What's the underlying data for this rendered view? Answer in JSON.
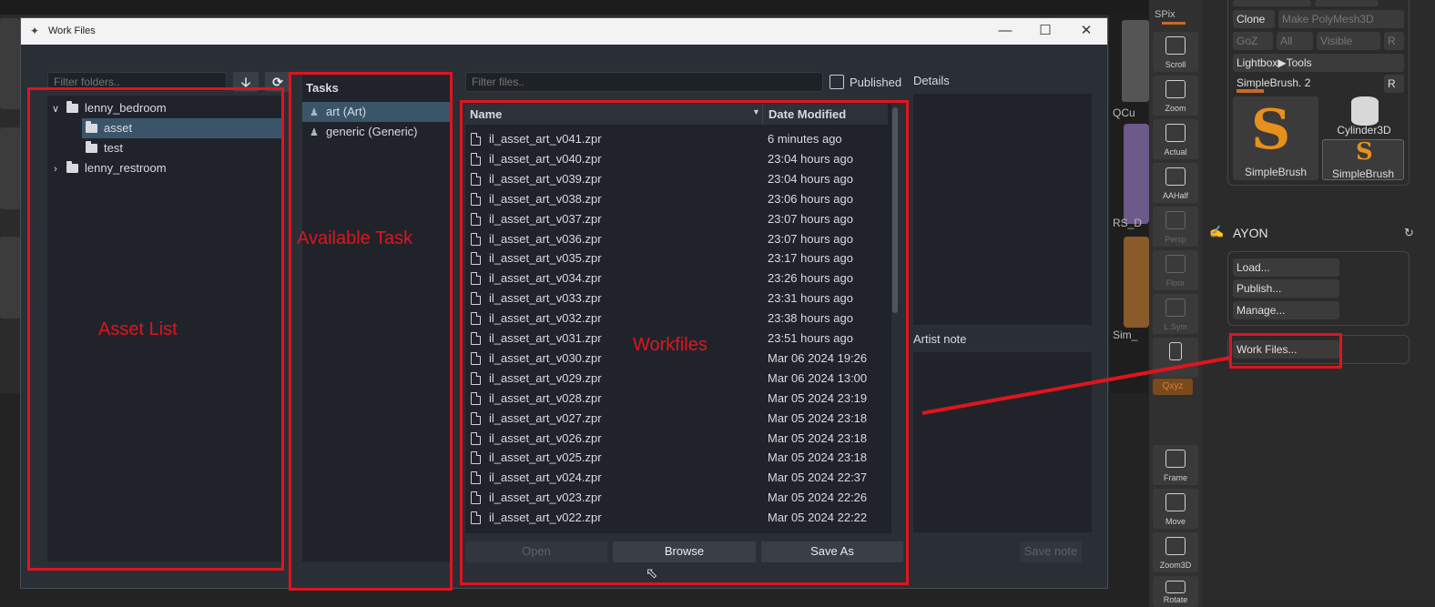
{
  "window": {
    "title": "Work Files"
  },
  "folders": {
    "filter_placeholder": "Filter folders..",
    "tree": [
      {
        "label": "lenny_bedroom",
        "expanded": true
      },
      {
        "label": "asset",
        "selected": true
      },
      {
        "label": "test"
      },
      {
        "label": "lenny_restroom",
        "expanded": false
      }
    ]
  },
  "tasks": {
    "header": "Tasks",
    "items": [
      {
        "label": "art (Art)",
        "selected": true
      },
      {
        "label": "generic (Generic)"
      }
    ]
  },
  "files": {
    "filter_placeholder": "Filter files..",
    "published_label": "Published",
    "columns": [
      "Name",
      "Date Modified"
    ],
    "rows": [
      [
        "il_asset_art_v041.zpr",
        "6 minutes ago"
      ],
      [
        "il_asset_art_v040.zpr",
        "23:04 hours ago"
      ],
      [
        "il_asset_art_v039.zpr",
        "23:04 hours ago"
      ],
      [
        "il_asset_art_v038.zpr",
        "23:06 hours ago"
      ],
      [
        "il_asset_art_v037.zpr",
        "23:07 hours ago"
      ],
      [
        "il_asset_art_v036.zpr",
        "23:07 hours ago"
      ],
      [
        "il_asset_art_v035.zpr",
        "23:17 hours ago"
      ],
      [
        "il_asset_art_v034.zpr",
        "23:26 hours ago"
      ],
      [
        "il_asset_art_v033.zpr",
        "23:31 hours ago"
      ],
      [
        "il_asset_art_v032.zpr",
        "23:38 hours ago"
      ],
      [
        "il_asset_art_v031.zpr",
        "23:51 hours ago"
      ],
      [
        "il_asset_art_v030.zpr",
        "Mar 06 2024 19:26"
      ],
      [
        "il_asset_art_v029.zpr",
        "Mar 06 2024 13:00"
      ],
      [
        "il_asset_art_v028.zpr",
        "Mar 05 2024 23:19"
      ],
      [
        "il_asset_art_v027.zpr",
        "Mar 05 2024 23:18"
      ],
      [
        "il_asset_art_v026.zpr",
        "Mar 05 2024 23:18"
      ],
      [
        "il_asset_art_v025.zpr",
        "Mar 05 2024 23:18"
      ],
      [
        "il_asset_art_v024.zpr",
        "Mar 05 2024 22:37"
      ],
      [
        "il_asset_art_v023.zpr",
        "Mar 05 2024 22:26"
      ],
      [
        "il_asset_art_v022.zpr",
        "Mar 05 2024 22:22"
      ]
    ],
    "buttons": {
      "open": "Open",
      "browse": "Browse",
      "save_as": "Save As"
    }
  },
  "details": {
    "header": "Details",
    "artist_note": "Artist note",
    "save_note": "Save note"
  },
  "annotations": {
    "asset_list": "Asset List",
    "available_task": "Available Task",
    "workfiles": "Workfiles"
  },
  "zbrush": {
    "tools": [
      "SPix",
      "Scroll",
      "Zoom",
      "Actual",
      "AAHalf",
      "Persp",
      "Floor",
      "L.Sym",
      "Frame",
      "Move",
      "Zoom3D",
      "Rotate"
    ],
    "buttons": {
      "clone": "Clone",
      "make_polymesh": "Make PolyMesh3D",
      "goz": "GoZ",
      "all": "All",
      "visible": "Visible",
      "r": "R",
      "lightbox": "Lightbox▶Tools",
      "simplebrush_slider": "SimpleBrush. 2",
      "thumb_big": "SimpleBrush",
      "thumb_cyl": "Cylinder3D",
      "thumb_small": "SimpleBrush"
    },
    "side_labels": [
      "QCu",
      "RS_D",
      "Sim_"
    ],
    "ayon": {
      "title": "AYON",
      "load": "Load...",
      "publish": "Publish...",
      "manage": "Manage...",
      "work_files": "Work Files..."
    }
  },
  "colors": {
    "accent_red": "#e0141e",
    "selection": "#3a5569"
  }
}
